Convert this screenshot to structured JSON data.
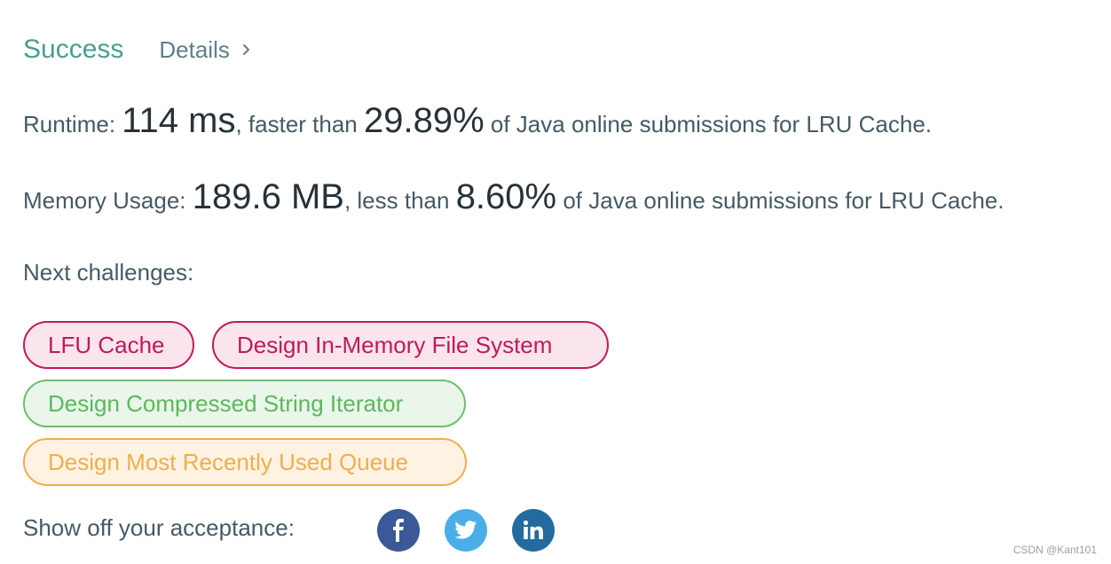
{
  "header": {
    "status": "Success",
    "details_label": "Details"
  },
  "runtime": {
    "label": "Runtime: ",
    "value": "114 ms",
    "comparison": ", faster than ",
    "percent": "29.89%",
    "suffix": " of Java online submissions for LRU Cache."
  },
  "memory": {
    "label": "Memory Usage: ",
    "value": "189.6 MB",
    "comparison": ", less than ",
    "percent": "8.60%",
    "suffix": " of Java online submissions for LRU Cache."
  },
  "next_challenges": {
    "label": "Next challenges:",
    "items": [
      {
        "label": "LFU Cache",
        "difficulty": "hard",
        "color": "#c2185b"
      },
      {
        "label": "Design In-Memory File System",
        "difficulty": "hard",
        "color": "#c2185b"
      },
      {
        "label": "Design Compressed String Iterator",
        "difficulty": "easy",
        "color": "#5cb85c"
      },
      {
        "label": "Design Most Recently Used Queue",
        "difficulty": "medium",
        "color": "#f0ad4e"
      }
    ]
  },
  "share": {
    "label": "Show off your acceptance:",
    "icons": [
      "facebook-icon",
      "twitter-icon",
      "linkedin-icon"
    ]
  },
  "colors": {
    "success": "#4a9f8f",
    "facebook": "#3b5998",
    "twitter": "#4aaee8",
    "linkedin": "#236b9e"
  },
  "watermark": "CSDN @Kant101"
}
